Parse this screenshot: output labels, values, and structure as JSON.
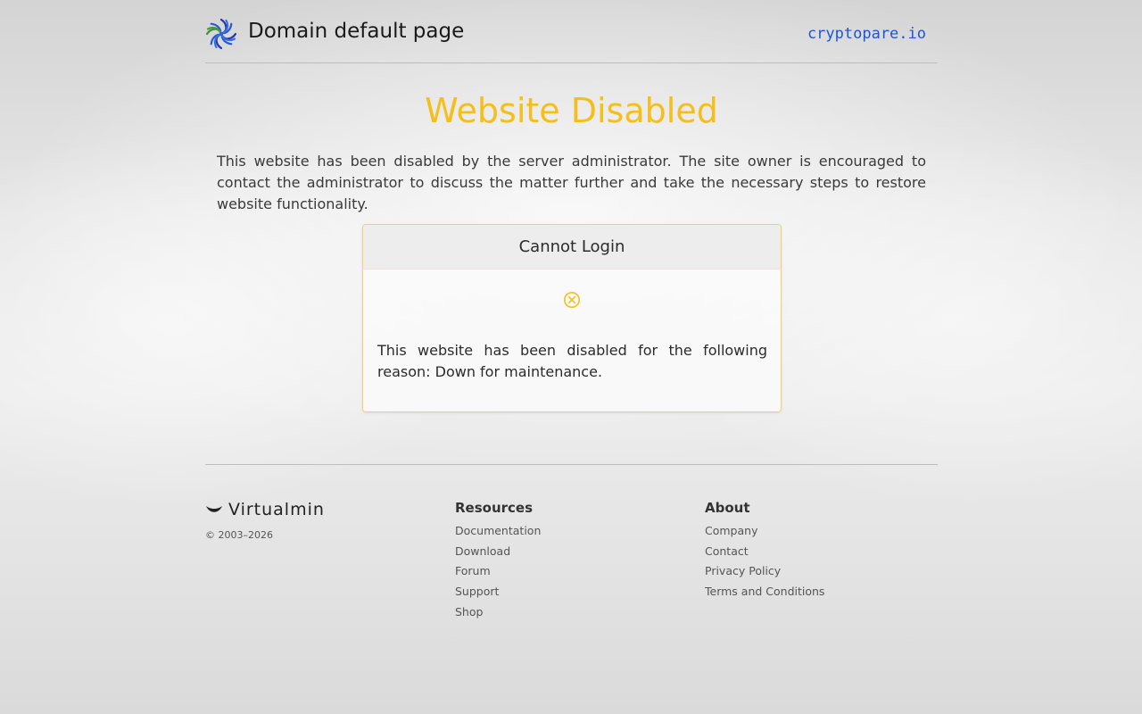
{
  "header": {
    "title": "Domain default page",
    "domain": "cryptopare.io",
    "logo_icon": "virtualmin-swirl-icon"
  },
  "main": {
    "heading": "Website Disabled",
    "intro": "This website has been disabled by the server administrator. The site owner is encouraged to contact the administrator to discuss the matter further and take the necessary steps to restore website functionality.",
    "card": {
      "title": "Cannot Login",
      "icon": "error-circle-x-icon",
      "message": "This website has been disabled for the following reason: Down for maintenance."
    }
  },
  "footer": {
    "brand": "Virtualmin",
    "copyright": "© 2003–2026",
    "resources": {
      "heading": "Resources",
      "links": [
        "Documentation",
        "Download",
        "Forum",
        "Support",
        "Shop"
      ]
    },
    "about": {
      "heading": "About",
      "links": [
        "Company",
        "Contact",
        "Privacy Policy",
        "Terms and Conditions"
      ]
    }
  },
  "colors": {
    "accent": "#f6be1a",
    "link": "#1a56db",
    "card_border": "#f2d26a"
  }
}
